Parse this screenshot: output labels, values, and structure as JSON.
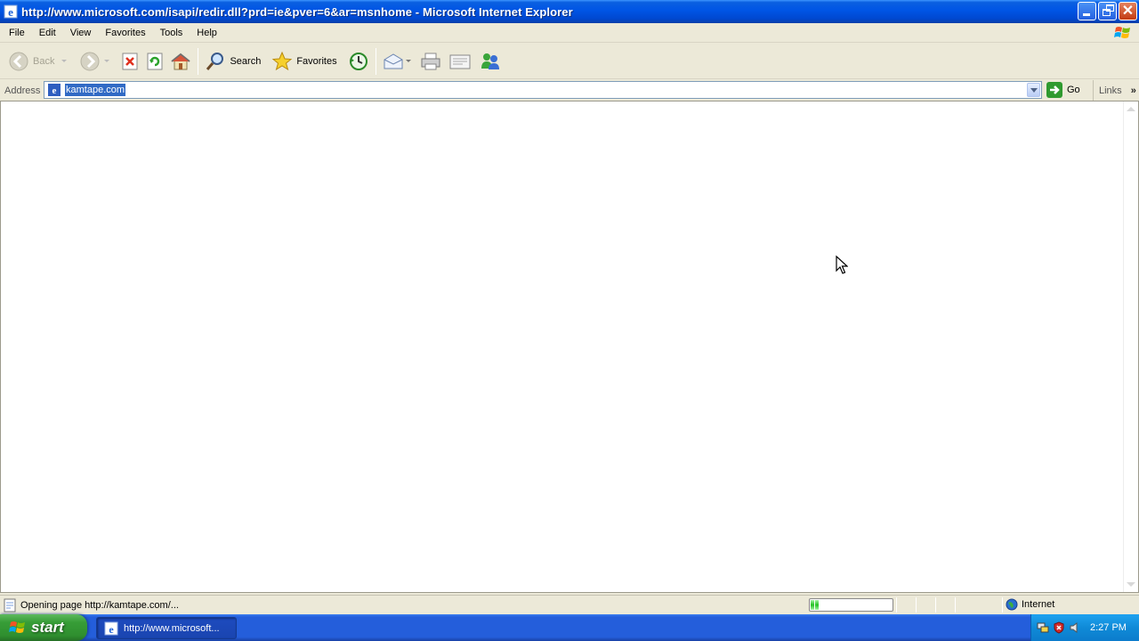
{
  "window": {
    "title": "http://www.microsoft.com/isapi/redir.dll?prd=ie&pver=6&ar=msnhome - Microsoft Internet Explorer"
  },
  "menubar": {
    "items": [
      {
        "label": "File"
      },
      {
        "label": "Edit"
      },
      {
        "label": "View"
      },
      {
        "label": "Favorites"
      },
      {
        "label": "Tools"
      },
      {
        "label": "Help"
      }
    ]
  },
  "toolbar": {
    "back_label": "Back",
    "search_label": "Search",
    "favorites_label": "Favorites"
  },
  "address": {
    "label": "Address",
    "value": "kamtape.com",
    "go_label": "Go",
    "links_label": "Links"
  },
  "status": {
    "text": "Opening page http://kamtape.com/...",
    "progress_segments": 2,
    "zone_label": "Internet"
  },
  "taskbar": {
    "start_label": "start",
    "task_label": "http://www.microsoft...",
    "clock": "2:27 PM"
  },
  "icons": {
    "accent": "#0055e5",
    "start_green": "#379d37"
  }
}
